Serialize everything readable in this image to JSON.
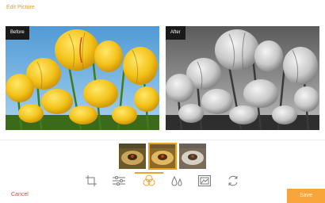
{
  "header": {
    "title": "Edit Picture"
  },
  "preview": {
    "before_label": "Before",
    "after_label": "After"
  },
  "filters": [
    {
      "name": "warm-filter",
      "selected": false
    },
    {
      "name": "vintage-filter",
      "selected": true
    },
    {
      "name": "silver-filter",
      "selected": false
    }
  ],
  "toolbar": {
    "tools": [
      "crop-icon",
      "adjust-sliders-icon",
      "filters-icon",
      "drops-icon",
      "image-frame-icon",
      "rotate-icon"
    ],
    "active_tool": "filters-icon"
  },
  "footer": {
    "cancel_label": "Cancel",
    "save_label": "Save"
  },
  "colors": {
    "accent": "#f7a43a",
    "title": "#e0a030",
    "cancel": "#d04a3a"
  }
}
